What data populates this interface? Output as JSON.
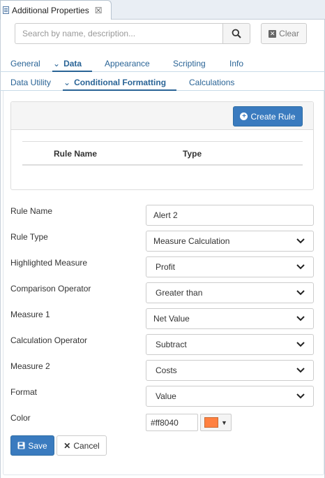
{
  "window": {
    "tab_title": "Additional Properties",
    "close_symbol": "☒"
  },
  "search": {
    "placeholder": "Search by name, description...",
    "value": "",
    "clear_label": "Clear"
  },
  "tabs_primary": [
    {
      "label": "General",
      "active": false
    },
    {
      "label": "Data",
      "active": true
    },
    {
      "label": "Appearance",
      "active": false
    },
    {
      "label": "Scripting",
      "active": false
    },
    {
      "label": "Info",
      "active": false
    }
  ],
  "tabs_secondary": [
    {
      "label": "Data Utility",
      "active": false
    },
    {
      "label": "Conditional Formatting",
      "active": true
    },
    {
      "label": "Calculations",
      "active": false
    }
  ],
  "rules_table": {
    "create_label": "Create Rule",
    "columns": [
      "Rule Name",
      "Type"
    ],
    "rows": []
  },
  "form": {
    "rule_name": {
      "label": "Rule Name",
      "value": "Alert 2"
    },
    "rule_type": {
      "label": "Rule Type",
      "value": "Measure Calculation"
    },
    "highlighted_measure": {
      "label": "Highlighted Measure",
      "value": "Profit"
    },
    "comparison_operator": {
      "label": "Comparison Operator",
      "value": "Greater than"
    },
    "measure1": {
      "label": "Measure 1",
      "value": "Net Value"
    },
    "calculation_operator": {
      "label": "Calculation Operator",
      "value": "Subtract"
    },
    "measure2": {
      "label": "Measure 2",
      "value": "Costs"
    },
    "format": {
      "label": "Format",
      "value": "Value"
    },
    "color": {
      "label": "Color",
      "value": "#ff8040",
      "swatch": "#ff8040"
    }
  },
  "actions": {
    "save_label": "Save",
    "cancel_label": "Cancel"
  },
  "colors": {
    "accent": "#3a7bbf",
    "link": "#2a6496"
  }
}
